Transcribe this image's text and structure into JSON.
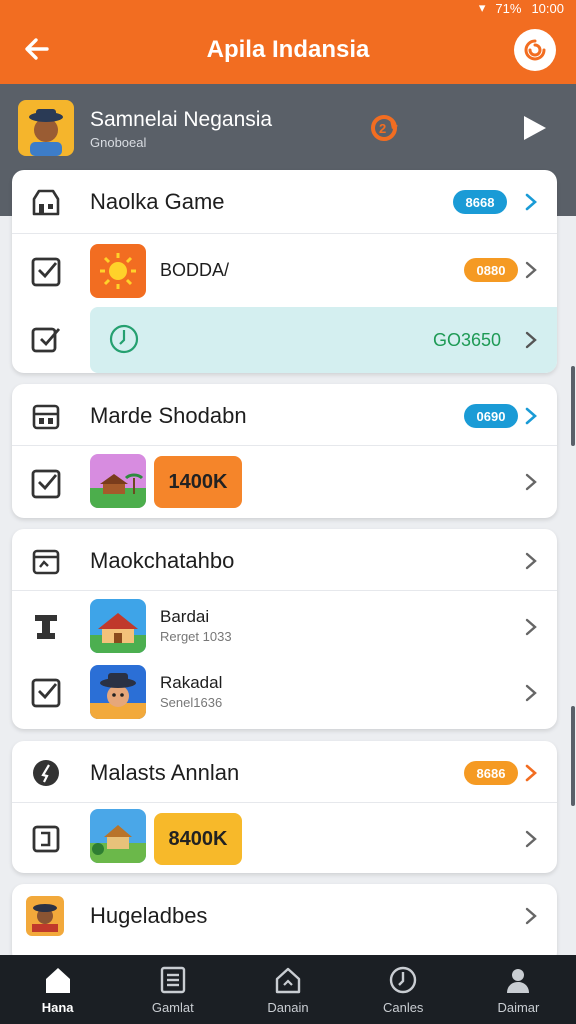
{
  "status_bar": {
    "battery": "71%",
    "time": "10:00"
  },
  "topbar": {
    "title": "Apila Indansia"
  },
  "hero": {
    "title": "Samnelai Negansia",
    "subtitle": "Gnoboeal"
  },
  "sections": [
    {
      "title": "Naolka Game",
      "badge": "8668",
      "rows": [
        {
          "label": "BODDA/",
          "badge": "0880"
        },
        {
          "info_value": "GO3650"
        }
      ]
    },
    {
      "title": "Marde Shodabn",
      "badge": "0690",
      "rows": [
        {
          "tag": "1400K"
        }
      ]
    },
    {
      "title": "Maokchatahbo",
      "rows": [
        {
          "label": "Bardai",
          "sublabel": "Rerget 1033"
        },
        {
          "label": "Rakadal",
          "sublabel": "Senel1636"
        }
      ]
    },
    {
      "title": "Malasts Annlan",
      "badge": "8686",
      "rows": [
        {
          "tag": "8400K"
        }
      ]
    },
    {
      "title": "Hugeladbes"
    }
  ],
  "nav": [
    {
      "label": "Hana",
      "icon": "home-icon"
    },
    {
      "label": "Gamlat",
      "icon": "list-icon"
    },
    {
      "label": "Danain",
      "icon": "house-outline-icon"
    },
    {
      "label": "Canles",
      "icon": "clock-icon"
    },
    {
      "label": "Daimar",
      "icon": "person-icon"
    }
  ],
  "colors": {
    "accent": "#f26d21",
    "hero": "#5a6068",
    "badge_blue": "#1a9bd6",
    "badge_orange": "#f59a23",
    "nav_bg": "#1b1f24"
  }
}
